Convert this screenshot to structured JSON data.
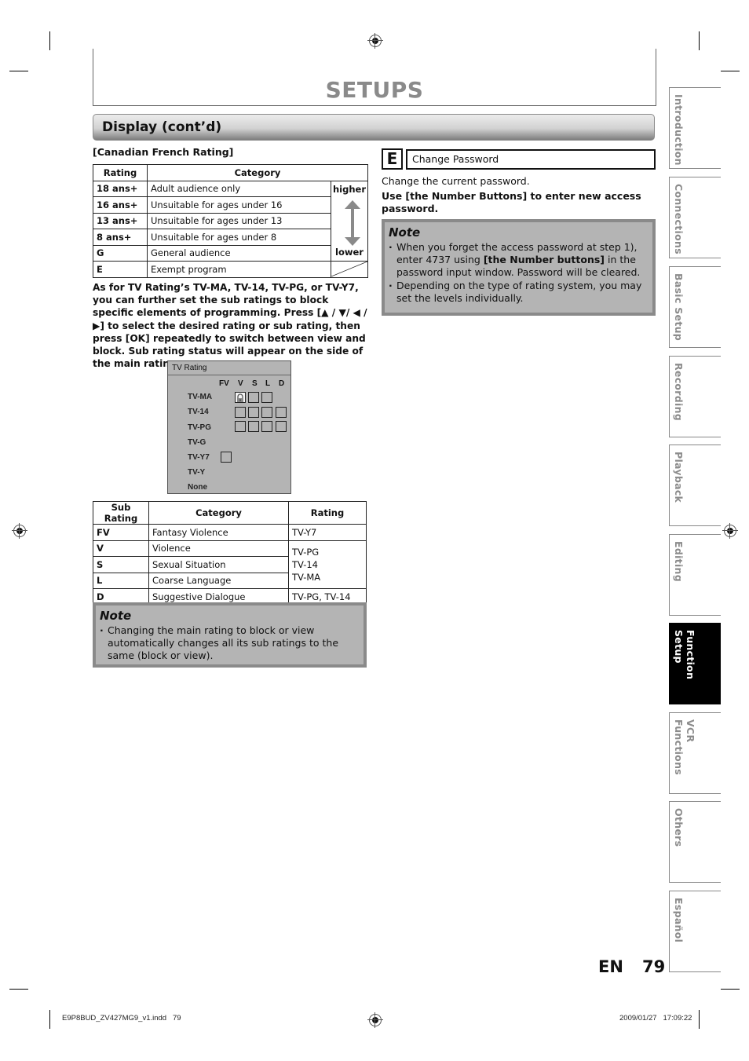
{
  "header": {
    "title": "SETUPS",
    "section": "Display (cont’d)"
  },
  "canadian_french": {
    "heading": "[Canadian French Rating]",
    "columns": [
      "Rating",
      "Category"
    ],
    "rows": [
      {
        "rating": "18 ans+",
        "category": "Adult audience only"
      },
      {
        "rating": "16 ans+",
        "category": "Unsuitable for ages under 16"
      },
      {
        "rating": "13 ans+",
        "category": "Unsuitable for ages under 13"
      },
      {
        "rating": "8 ans+",
        "category": "Unsuitable for ages under 8"
      },
      {
        "rating": "G",
        "category": "General audience"
      },
      {
        "rating": "E",
        "category": "Exempt program"
      }
    ],
    "scale_high": "higher",
    "scale_low": "lower",
    "scale_icon": "double-arrow-icon"
  },
  "instructions": "As for TV Rating’s TV-MA, TV-14, TV-PG, or TV-Y7, you can further set the sub ratings to block specific elements of programming. Press [▲ / ▼/ ◀ / ▶] to select the desired rating or sub rating, then press [OK] repeatedly to switch between view and block. Sub rating status will appear on the side of the main rating.",
  "osd": {
    "title": "TV Rating",
    "columns": [
      "FV",
      "V",
      "S",
      "L",
      "D"
    ],
    "rows": [
      "TV-MA",
      "TV-14",
      "TV-PG",
      "TV-G",
      "TV-Y7",
      "TV-Y",
      "None"
    ],
    "locked_cell": "TV-MA / V",
    "lock_icon": "padlock-icon"
  },
  "sub_ratings": {
    "columns": [
      "Sub Rating",
      "Category",
      "Rating"
    ],
    "rows": [
      {
        "key": "FV",
        "category": "Fantasy Violence",
        "rating": "TV-Y7"
      },
      {
        "key": "V",
        "category": "Violence"
      },
      {
        "key": "S",
        "category": "Sexual Situation"
      },
      {
        "key": "L",
        "category": "Coarse Language"
      },
      {
        "key": "D",
        "category": "Suggestive Dialogue",
        "rating": "TV-PG, TV-14"
      }
    ],
    "merged_rating": [
      "TV-PG",
      "TV-14",
      "TV-MA"
    ]
  },
  "note_left": {
    "title": "Note",
    "items": [
      "Changing the main rating to block or view automatically changes all its sub ratings to the same (block or view)."
    ]
  },
  "step_e": {
    "badge": "E",
    "label": "Change Password",
    "desc": "Change the current password.",
    "instruction": "Use [the Number Buttons] to enter new access password."
  },
  "note_right": {
    "title": "Note",
    "item1_pre": "When you forget the access password at step 1), enter 4737 using ",
    "item1_bold": "[the Number buttons]",
    "item1_post": " in the password input window. Password will be cleared.",
    "item2": "Depending on the type of rating system, you may set the levels individually."
  },
  "side_tabs": [
    {
      "label": "Introduction",
      "active": false
    },
    {
      "label": "Connections",
      "active": false
    },
    {
      "label": "Basic Setup",
      "active": false
    },
    {
      "label": "Recording",
      "active": false
    },
    {
      "label": "Playback",
      "active": false
    },
    {
      "label": "Editing",
      "active": false
    },
    {
      "label": "Function Setup",
      "active": true
    },
    {
      "label": "VCR Functions",
      "active": false
    },
    {
      "label": "Others",
      "active": false
    },
    {
      "label": "Español",
      "active": false
    }
  ],
  "footer": {
    "lang": "EN",
    "page": "79",
    "file": "E9P8BUD_ZV427MG9_v1.indd   79",
    "timestamp": "2009/01/27   17:09:22"
  },
  "colors": {
    "note_bg": "#b4b4b4",
    "note_border": "#8a8a8a",
    "title_gray": "#8a8a8a",
    "active_tab": "#000000"
  }
}
